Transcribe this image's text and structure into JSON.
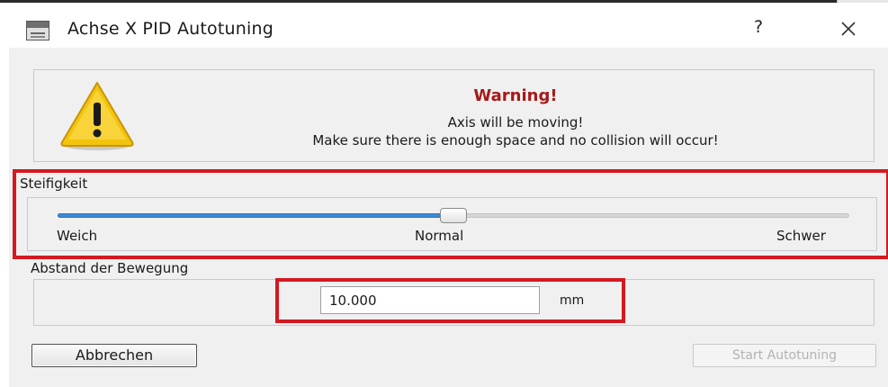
{
  "window": {
    "title": "Achse X PID Autotuning",
    "help_label": "?",
    "close_icon": "close-icon"
  },
  "warning": {
    "icon": "warning-icon",
    "title": "Warning!",
    "line1": "Axis will be moving!",
    "line2": "Make sure there is enough space and no collision will occur!"
  },
  "stiffness": {
    "label": "Steifigkeit",
    "value_fraction": 0.5,
    "tick_left": "Weich",
    "tick_mid": "Normal",
    "tick_right": "Schwer"
  },
  "distance": {
    "label": "Abstand der Bewegung",
    "value": "10.000",
    "unit": "mm"
  },
  "buttons": {
    "cancel": "Abbrechen",
    "start": "Start Autotuning",
    "start_enabled": false
  },
  "colors": {
    "highlight": "#d41920",
    "warning_title": "#a51a1a",
    "slider_fill": "#3b8bd6",
    "warning_triangle": "#f2c40c"
  }
}
